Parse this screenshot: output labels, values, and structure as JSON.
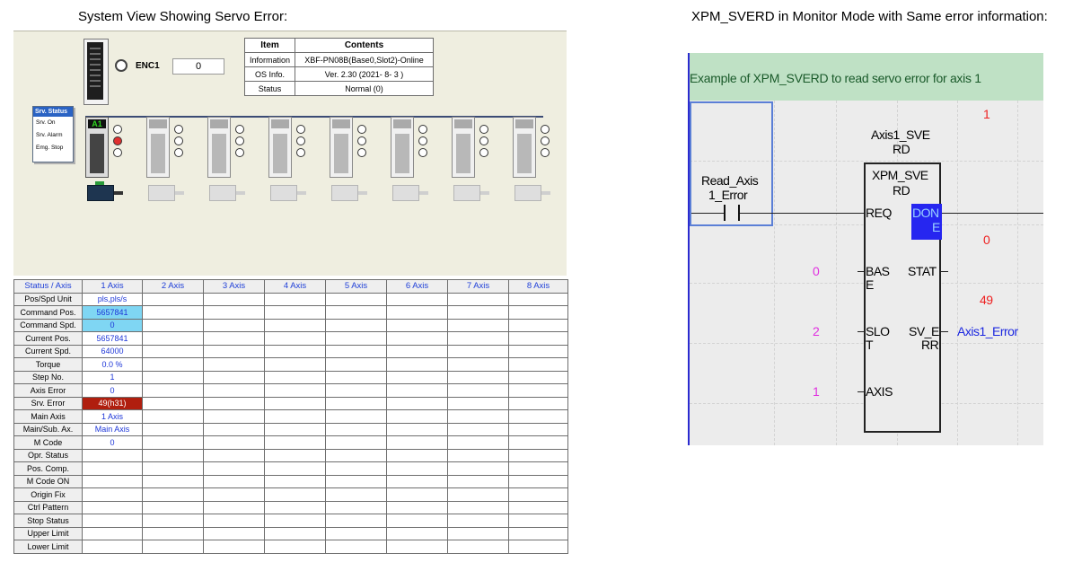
{
  "captions": {
    "left": "System View Showing Servo Error:",
    "right": "XPM_SVERD in Monitor Mode with Same error information:"
  },
  "system_view": {
    "encoder": {
      "label": "ENC1",
      "value": "0"
    },
    "info_table": {
      "header": {
        "item": "Item",
        "contents": "Contents"
      },
      "rows": [
        {
          "item": "Information",
          "contents": "XBF-PN08B(Base0,Slot2)-Online"
        },
        {
          "item": "OS Info.",
          "contents": "Ver.  2.30 (2021- 8- 3 )"
        },
        {
          "item": "Status",
          "contents": "Normal (0)"
        }
      ]
    },
    "servo_status_box": {
      "title": "Srv. Status",
      "items": [
        "Srv. On",
        "Srv. Alarm",
        "Emg. Stop"
      ]
    },
    "active_axis_label": "A1",
    "status_table": {
      "headers": [
        "Status / Axis",
        "1 Axis",
        "2 Axis",
        "3 Axis",
        "4 Axis",
        "5 Axis",
        "6 Axis",
        "7 Axis",
        "8 Axis"
      ],
      "rows": [
        {
          "label": "Pos/Spd Unit",
          "axis1": "pls,pls/s",
          "style": "val"
        },
        {
          "label": "Command Pos.",
          "axis1": "5657841",
          "style": "cyan"
        },
        {
          "label": "Command Spd.",
          "axis1": "0",
          "style": "cyan"
        },
        {
          "label": "Current Pos.",
          "axis1": "5657841",
          "style": "val"
        },
        {
          "label": "Current Spd.",
          "axis1": "64000",
          "style": "val"
        },
        {
          "label": "Torque",
          "axis1": "0.0 %",
          "style": "val"
        },
        {
          "label": "Step No.",
          "axis1": "1",
          "style": "val"
        },
        {
          "label": "Axis Error",
          "axis1": "0",
          "style": "val"
        },
        {
          "label": "Srv. Error",
          "axis1": "49(h31)",
          "style": "err"
        },
        {
          "label": "Main Axis",
          "axis1": "1 Axis",
          "style": "val"
        },
        {
          "label": "Main/Sub. Ax.",
          "axis1": "Main Axis",
          "style": "val"
        },
        {
          "label": "M Code",
          "axis1": "0",
          "style": "val"
        },
        {
          "label": "Opr. Status",
          "axis1": "",
          "style": "val"
        },
        {
          "label": "Pos. Comp.",
          "axis1": "",
          "style": "val"
        },
        {
          "label": "M Code ON",
          "axis1": "",
          "style": "val"
        },
        {
          "label": "Origin Fix",
          "axis1": "",
          "style": "val"
        },
        {
          "label": "Ctrl Pattern",
          "axis1": "",
          "style": "val"
        },
        {
          "label": "Stop Status",
          "axis1": "",
          "style": "val"
        },
        {
          "label": "Upper Limit",
          "axis1": "",
          "style": "val"
        },
        {
          "label": "Lower Limit",
          "axis1": "",
          "style": "val"
        }
      ]
    }
  },
  "ladder": {
    "comment": "Example of XPM_SVERD to read servo error for axis 1",
    "contact": {
      "line1": "Read_Axis",
      "line2": "1_Error"
    },
    "instance": {
      "line1": "Axis1_SVE",
      "line2": "RD",
      "value": "1"
    },
    "fb_name": {
      "line1": "XPM_SVE",
      "line2": "RD"
    },
    "inputs": {
      "req": "REQ",
      "base": {
        "l1": "BAS",
        "l2": "E",
        "value": "0"
      },
      "slot": {
        "l1": "SLO",
        "l2": "T",
        "value": "2"
      },
      "axis": {
        "l1": "AXIS",
        "value": "1"
      }
    },
    "outputs": {
      "done": {
        "l1": "DON",
        "l2": "E"
      },
      "stat": {
        "l1": "STAT",
        "value": "0"
      },
      "sverr": {
        "l1": "SV_E",
        "l2": "RR",
        "value": "49",
        "variable": "Axis1_Error"
      }
    }
  }
}
